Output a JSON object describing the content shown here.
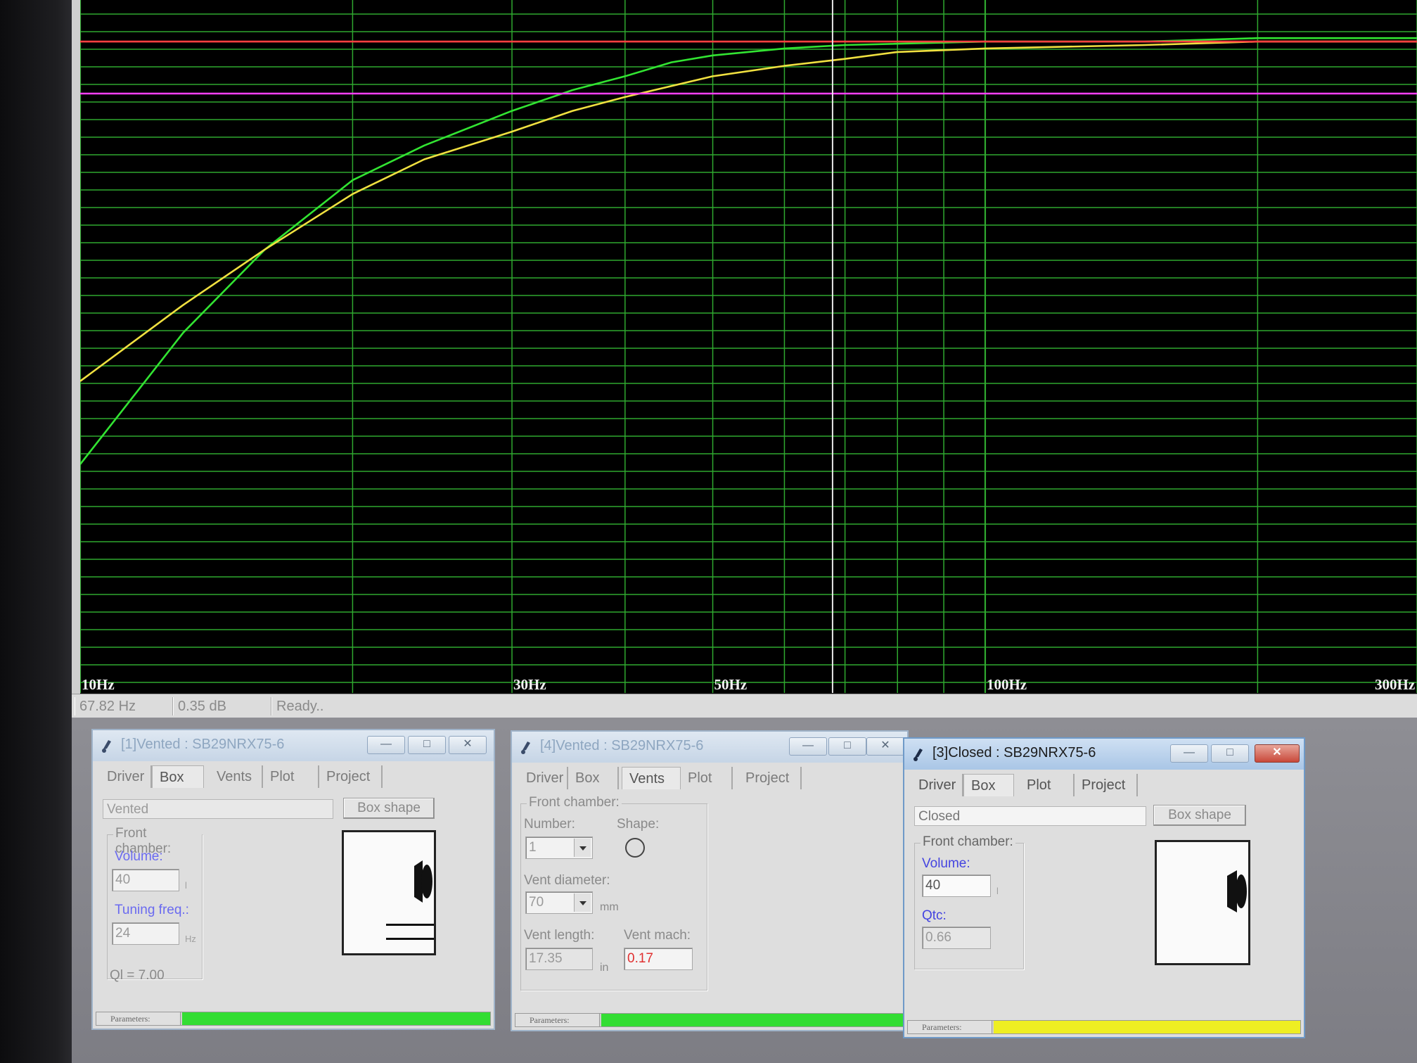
{
  "chart_data": {
    "type": "line",
    "x_scale": "log",
    "xlim": [
      10,
      300
    ],
    "tick_labels": [
      "10Hz",
      "30Hz",
      "50Hz",
      "100Hz",
      "300Hz"
    ],
    "grid": true,
    "cursor_x": 67.82,
    "series": [
      {
        "color": "#32e432",
        "x": [
          10,
          13,
          16,
          20,
          24,
          30,
          35,
          40,
          45,
          50,
          60,
          70,
          100,
          150,
          200,
          300
        ],
        "y": [
          0.33,
          0.52,
          0.64,
          0.74,
          0.79,
          0.84,
          0.87,
          0.89,
          0.91,
          0.92,
          0.93,
          0.935,
          0.94,
          0.94,
          0.945,
          0.945
        ]
      },
      {
        "color": "#f0e040",
        "x": [
          10,
          13,
          16,
          20,
          24,
          30,
          35,
          40,
          50,
          60,
          70,
          80,
          100,
          150,
          200,
          300
        ],
        "y": [
          0.45,
          0.56,
          0.64,
          0.72,
          0.77,
          0.81,
          0.84,
          0.86,
          0.89,
          0.905,
          0.915,
          0.925,
          0.93,
          0.935,
          0.94,
          0.94
        ]
      },
      {
        "color": "#ff4040",
        "x": [
          10,
          300
        ],
        "y": [
          0.94,
          0.94
        ]
      },
      {
        "color": "#ff40ff",
        "x": [
          10,
          300
        ],
        "y": [
          0.865,
          0.865
        ]
      }
    ]
  },
  "status": {
    "freq": "67.82 Hz",
    "db": "0.35 dB",
    "message": "Ready.."
  },
  "windows": {
    "w1": {
      "title": "[1]Vented : SB29NRX75-6",
      "tabs": [
        "Driver",
        "Box",
        "Vents",
        "Plot",
        "Project"
      ],
      "box_type": "Vented",
      "box_shape_label": "Box shape",
      "group_title": "Front chamber:",
      "volume_label": "Volume:",
      "volume_value": "40",
      "volume_unit": "l",
      "tuning_label": "Tuning freq.:",
      "tuning_value": "24",
      "tuning_unit": "Hz",
      "ql_text": "Ql = 7.00",
      "params_label": "Parameters:",
      "params_color": "#33dd33"
    },
    "w4": {
      "title": "[4]Vented : SB29NRX75-6",
      "tabs": [
        "Driver",
        "Box",
        "Vents",
        "Plot",
        "Project"
      ],
      "group_title": "Front chamber:",
      "number_label": "Number:",
      "number_value": "1",
      "shape_label": "Shape:",
      "vent_diameter_label": "Vent diameter:",
      "vent_diameter_value": "70",
      "vent_diameter_unit": "mm",
      "vent_length_label": "Vent length:",
      "vent_length_value": "17.35",
      "vent_length_unit": "in",
      "vent_mach_label": "Vent mach:",
      "vent_mach_value": "0.17",
      "params_label": "Parameters:",
      "params_color": "#33dd33"
    },
    "w3": {
      "title": "[3]Closed : SB29NRX75-6",
      "tabs": [
        "Driver",
        "Box",
        "Plot",
        "Project"
      ],
      "box_type": "Closed",
      "box_shape_label": "Box shape",
      "group_title": "Front chamber:",
      "volume_label": "Volume:",
      "volume_value": "40",
      "volume_unit": "l",
      "qtc_label": "Qtc:",
      "qtc_value": "0.66",
      "params_label": "Parameters:",
      "params_color": "#eeee22"
    }
  }
}
